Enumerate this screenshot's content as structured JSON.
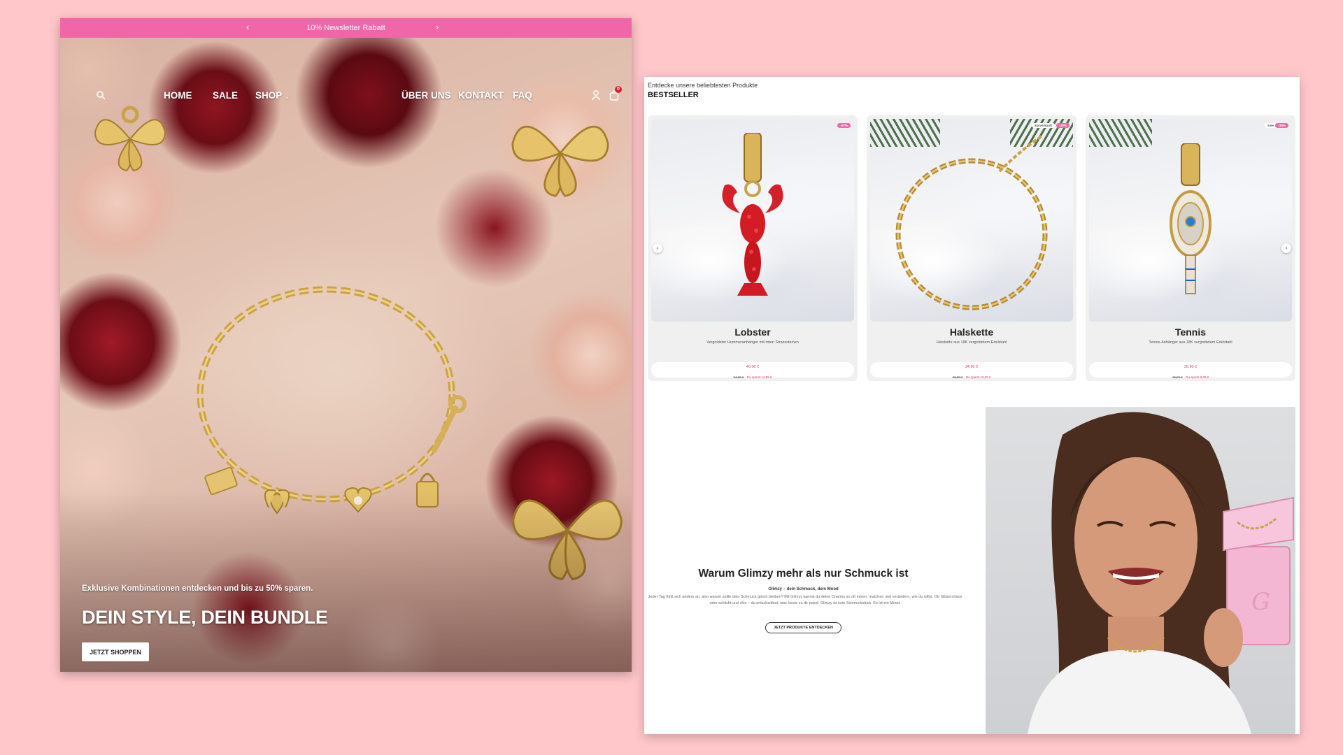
{
  "hero": {
    "announcement": "10% Newsletter Rabatt",
    "nav": {
      "items": [
        "HOME",
        "SALE",
        "SHOP",
        "ÜBER UNS",
        "KONTAKT",
        "FAQ"
      ],
      "cart_count": "0"
    },
    "subtitle": "Exklusive Kombinationen entdecken und bis zu 50% sparen.",
    "title": "DEIN STYLE, DEIN BUNDLE",
    "cta_label": "JETZT SHOPPEN"
  },
  "bestseller": {
    "kicker": "Entdecke unsere beliebtesten Produkte",
    "title": "BESTSELLER",
    "products": [
      {
        "name": "Lobster",
        "description": "Vergoldeter Hummeranhänger mit roten Strasssteinen",
        "price": "40,00 €",
        "old_price": "54,99 €",
        "savings": "Du sparst 14,99 €",
        "badges": [
          "-27%"
        ]
      },
      {
        "name": "Halskette",
        "description": "Halskette aus 18K vergoldetem Edelstahl",
        "price": "34,90 €",
        "old_price": "49,99 €",
        "savings": "Du sparst 15,09 €",
        "badges": [
          "ausverkauft",
          "-30%"
        ]
      },
      {
        "name": "Tennis",
        "description": "Tennis-Anhänger aus 18K vergoldetem Edelstahl",
        "price": "35,90 €",
        "old_price": "44,99 €",
        "savings": "Du sparst 9,09 €",
        "badges": [
          "Sale",
          "-20%"
        ]
      }
    ]
  },
  "why": {
    "title": "Warum Glimzy mehr als nur Schmuck ist",
    "subtitle": "Glimzy – dein Schmuck, dein Mood",
    "body": "Jeder Tag fühlt sich anders an, also warum sollte dein Schmuck gleich bleiben? Mit Glimzy kannst du deine Charms so oft mixen, matchen und verändern, wie du willst. Ob Glitzerchaos oder schlicht und chic – du entscheidest, was heute zu dir passt. Glimzy ist kein Schmuckstück. Es ist ein Mood.",
    "cta_label": "JETZT PRODUKTE ENTDECKEN"
  },
  "colors": {
    "page_bg": "#ffc7c9",
    "announcement_bg": "#ef67a8",
    "accent_pink": "#ec6aa5",
    "price_red": "#e23a6d"
  }
}
